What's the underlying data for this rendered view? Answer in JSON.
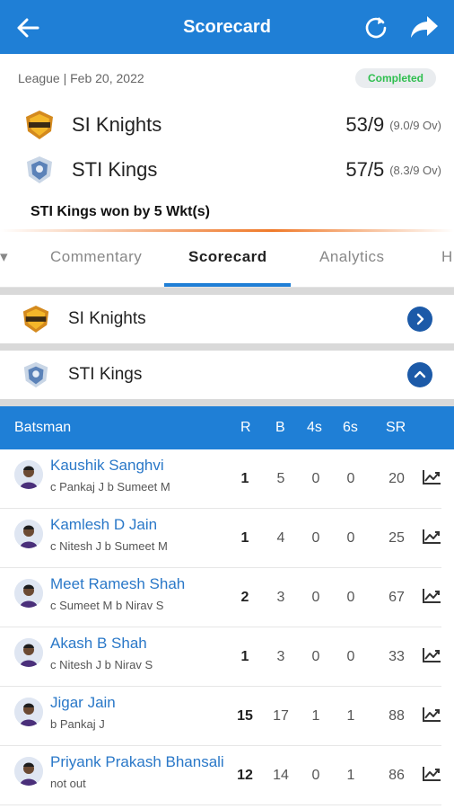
{
  "header": {
    "title": "Scorecard",
    "back_icon": "arrow-left-icon",
    "refresh_icon": "refresh-icon",
    "share_icon": "share-icon"
  },
  "match": {
    "meta": "League | Feb 20, 2022",
    "status": "Completed",
    "teams": [
      {
        "name": "SI Knights",
        "score": "53/9",
        "overs": "(9.0/9 Ov)"
      },
      {
        "name": "STI Kings",
        "score": "57/5",
        "overs": "(8.3/9 Ov)"
      }
    ],
    "result": "STI Kings won by 5 Wkt(s)"
  },
  "tabs": {
    "edge_left": "▾",
    "commentary": "Commentary",
    "scorecard": "Scorecard",
    "analytics": "Analytics",
    "edge_right": "H"
  },
  "innings": [
    {
      "name": "SI Knights",
      "toggle_icon": "chevron-right-icon"
    },
    {
      "name": "STI Kings",
      "toggle_icon": "chevron-up-icon"
    }
  ],
  "batting": {
    "headers": {
      "batsman": "Batsman",
      "r": "R",
      "b": "B",
      "fours": "4s",
      "sixes": "6s",
      "sr": "SR"
    },
    "rows": [
      {
        "name": "Kaushik Sanghvi",
        "dismissal": "c Pankaj J b Sumeet M",
        "r": "1",
        "b": "5",
        "fours": "0",
        "sixes": "0",
        "sr": "20"
      },
      {
        "name": "Kamlesh D Jain",
        "dismissal": "c Nitesh J b Sumeet M",
        "r": "1",
        "b": "4",
        "fours": "0",
        "sixes": "0",
        "sr": "25"
      },
      {
        "name": "Meet Ramesh Shah",
        "dismissal": "c Sumeet M b Nirav S",
        "r": "2",
        "b": "3",
        "fours": "0",
        "sixes": "0",
        "sr": "67"
      },
      {
        "name": "Akash B Shah",
        "dismissal": "c Nitesh J b Nirav S",
        "r": "1",
        "b": "3",
        "fours": "0",
        "sixes": "0",
        "sr": "33"
      },
      {
        "name": "Jigar Jain",
        "dismissal": "b Pankaj J",
        "r": "15",
        "b": "17",
        "fours": "1",
        "sixes": "1",
        "sr": "88"
      },
      {
        "name": "Priyank Prakash Bhansali",
        "dismissal": "not out",
        "r": "12",
        "b": "14",
        "fours": "0",
        "sixes": "1",
        "sr": "86"
      }
    ]
  },
  "colors": {
    "primary": "#1f7fd6",
    "dark_blue": "#1c5aa8",
    "status_green": "#2fbf4f",
    "link": "#2a78c8"
  }
}
